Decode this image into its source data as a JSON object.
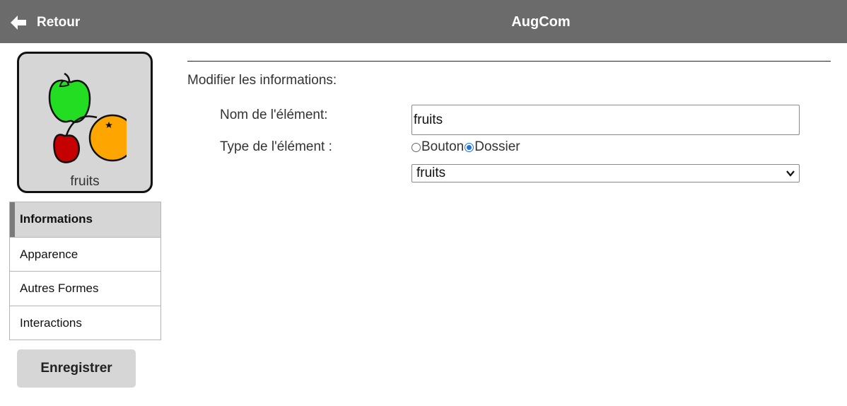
{
  "header": {
    "back_label": "Retour",
    "app_title": "AugCom"
  },
  "tile": {
    "label": "fruits",
    "image_icon": "fruits-icon"
  },
  "sidebar": {
    "items": [
      {
        "label": "Informations",
        "active": true
      },
      {
        "label": "Apparence",
        "active": false
      },
      {
        "label": "Autres Formes",
        "active": false
      },
      {
        "label": "Interactions",
        "active": false
      }
    ],
    "save_label": "Enregistrer"
  },
  "form": {
    "section_title": "Modifier les informations:",
    "name_label": "Nom de l'élément:",
    "name_value": "fruits",
    "type_label": "Type de l'élément :",
    "type_options": [
      {
        "label": "Bouton",
        "checked": false
      },
      {
        "label": "Dossier",
        "checked": true
      }
    ],
    "folder_select_value": "fruits"
  },
  "colors": {
    "header_bg": "#6b6b6b",
    "tile_bg": "#d6d6d6",
    "radio_accent": "#1a73e8"
  }
}
